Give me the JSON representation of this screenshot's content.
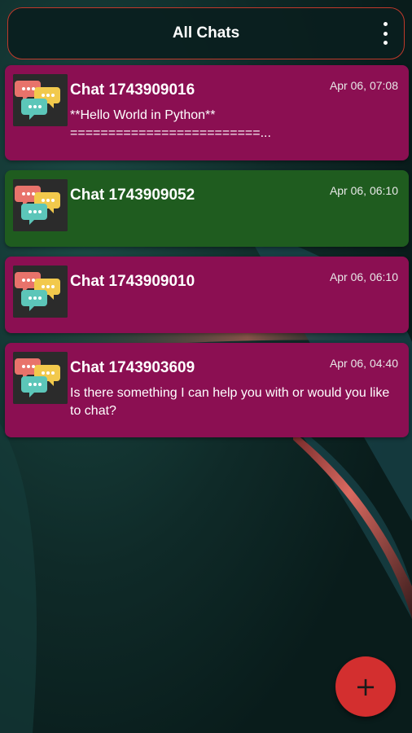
{
  "header": {
    "title": "All Chats",
    "menu_icon": "more-vert-icon"
  },
  "chats": [
    {
      "name": "Chat 1743909016",
      "time": "Apr 06, 07:08",
      "preview": "**Hello World in Python**\n=========================...",
      "color": "#8b0f52",
      "avatar_icon": "chat-bubbles-icon"
    },
    {
      "name": "Chat 1743909052",
      "time": "Apr 06, 06:10",
      "preview": "",
      "color": "#1f5c1f",
      "avatar_icon": "chat-bubbles-icon"
    },
    {
      "name": "Chat 1743909010",
      "time": "Apr 06, 06:10",
      "preview": "",
      "color": "#8b0f52",
      "avatar_icon": "chat-bubbles-icon"
    },
    {
      "name": "Chat 1743903609",
      "time": "Apr 06, 04:40",
      "preview": "Is there something I can help you with or would you like to chat?",
      "color": "#8b0f52",
      "avatar_icon": "chat-bubbles-icon"
    }
  ],
  "fab": {
    "label": "+",
    "icon": "plus-icon",
    "color": "#d32f2f"
  }
}
